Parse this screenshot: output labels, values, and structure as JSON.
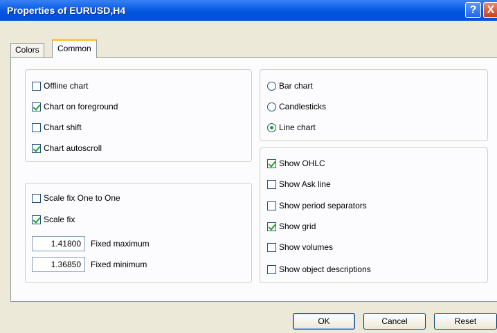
{
  "window": {
    "title": "Properties of EURUSD,H4",
    "help_label": "?",
    "close_label": "X"
  },
  "tabs": [
    {
      "label": "Colors"
    },
    {
      "label": "Common"
    }
  ],
  "chart_options": [
    {
      "label": "Offline chart",
      "checked": false
    },
    {
      "label": "Chart on foreground",
      "checked": true
    },
    {
      "label": "Chart shift",
      "checked": false
    },
    {
      "label": "Chart autoscroll",
      "checked": true
    }
  ],
  "scale": {
    "scale_one_to_one": {
      "label": "Scale fix One to One",
      "checked": false
    },
    "scale_fix": {
      "label": "Scale fix",
      "checked": true
    },
    "fixed_maximum": {
      "value": "1.41800",
      "label": "Fixed maximum"
    },
    "fixed_minimum": {
      "value": "1.36850",
      "label": "Fixed minimum"
    }
  },
  "chart_types": [
    {
      "label": "Bar chart",
      "selected": false
    },
    {
      "label": "Candlesticks",
      "selected": false
    },
    {
      "label": "Line chart",
      "selected": true
    }
  ],
  "show_options": [
    {
      "label": "Show OHLC",
      "checked": true
    },
    {
      "label": "Show Ask line",
      "checked": false
    },
    {
      "label": "Show period separators",
      "checked": false
    },
    {
      "label": "Show grid",
      "checked": true
    },
    {
      "label": "Show volumes",
      "checked": false
    },
    {
      "label": "Show object descriptions",
      "checked": false
    }
  ],
  "buttons": {
    "ok": "OK",
    "cancel": "Cancel",
    "reset": "Reset"
  }
}
